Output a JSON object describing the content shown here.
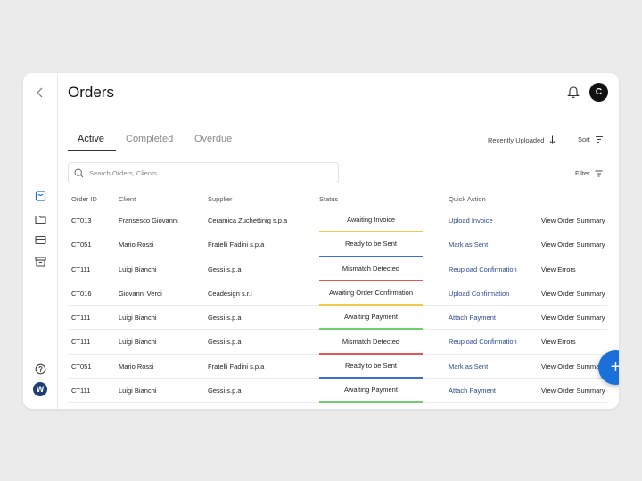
{
  "page": {
    "title": "Orders",
    "avatar_initial": "C"
  },
  "sidebar": {
    "icons": [
      "chevron-left-icon",
      "shopping-bag-icon",
      "folder-icon",
      "credit-card-icon",
      "archive-icon",
      "help-icon",
      "brand-logo-icon"
    ],
    "logo_letter": "W"
  },
  "tabs": [
    {
      "label": "Active",
      "active": true
    },
    {
      "label": "Completed",
      "active": false
    },
    {
      "label": "Overdue",
      "active": false
    }
  ],
  "toolbar": {
    "recently_uploaded": "Recently Uploaded",
    "sort": "Sort",
    "filter": "Filter"
  },
  "search": {
    "placeholder": "Search Orders, Clients...",
    "value": ""
  },
  "table": {
    "headers": {
      "order_id": "Order ID",
      "client": "Client",
      "supplier": "Supplier",
      "status": "Status",
      "quick_action": "Quick Action"
    },
    "rows": [
      {
        "order_id": "CT013",
        "client": "Fransesco Giovanni",
        "supplier": "Ceramica Zuchettinig s.p.a",
        "status": "Awaiting Invoice",
        "status_color": "#f2c94c",
        "action": "Upload Invoice",
        "secondary": "View Order Summary"
      },
      {
        "order_id": "CT051",
        "client": "Mario Rossi",
        "supplier": "Fratelli Fadini s.p.a",
        "status": "Ready to be Sent",
        "status_color": "#3b6fd8",
        "action": "Mark as Sent",
        "secondary": "View Order Summary"
      },
      {
        "order_id": "CT111",
        "client": "Luigi Bianchi",
        "supplier": "Gessi s.p.a",
        "status": "Mismatch Detected",
        "status_color": "#e05a4f",
        "action": "Reupload Confirmation",
        "secondary": "View Errors"
      },
      {
        "order_id": "CT016",
        "client": "Giovanni Verdi",
        "supplier": "Ceadesign s.r.i",
        "status": "Awaiting Order Confirmation",
        "status_color": "#f2c94c",
        "action": "Upload Confirmation",
        "secondary": "View Order Summary"
      },
      {
        "order_id": "CT111",
        "client": "Luigi Bianchi",
        "supplier": "Gessi s.p.a",
        "status": "Awaiting Payment",
        "status_color": "#6fcf6f",
        "action": "Attach Payment",
        "secondary": "View Order Summary"
      },
      {
        "order_id": "CT111",
        "client": "Luigi Bianchi",
        "supplier": "Gessi s.p.a",
        "status": "Mismatch Detected",
        "status_color": "#e05a4f",
        "action": "Reupload Confirmation",
        "secondary": "View Errors"
      },
      {
        "order_id": "CT051",
        "client": "Mario Rossi",
        "supplier": "Fratelli Fadini s.p.a",
        "status": "Ready to be Sent",
        "status_color": "#3b6fd8",
        "action": "Mark as Sent",
        "secondary": "View Order Summary"
      },
      {
        "order_id": "CT111",
        "client": "Luigi Bianchi",
        "supplier": "Gessi s.p.a",
        "status": "Awaiting Payment",
        "status_color": "#6fcf6f",
        "action": "Attach Payment",
        "secondary": "View Order Summary"
      }
    ]
  },
  "fab": {
    "label": "+",
    "color": "#1a6fd8"
  },
  "colors": {
    "accent": "#1a6fd8",
    "link": "#2a4a8a"
  }
}
